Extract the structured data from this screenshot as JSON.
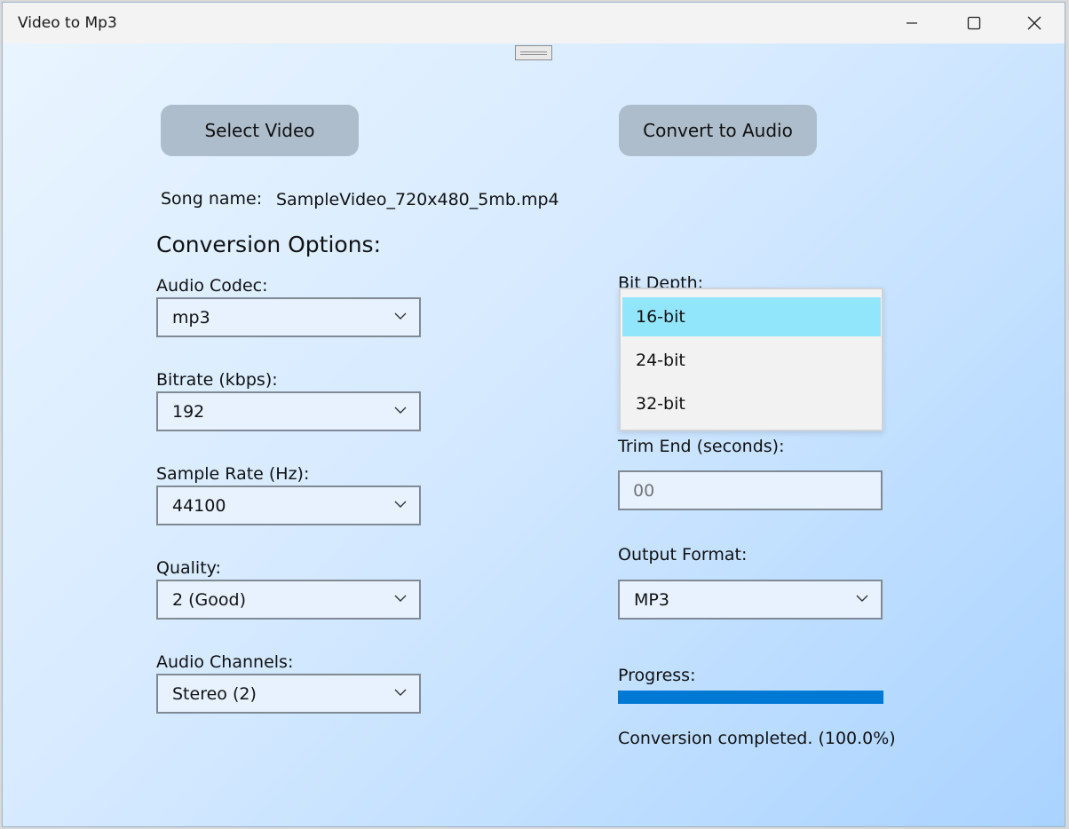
{
  "window": {
    "title": "Video to Mp3"
  },
  "actions": {
    "select_video_label": "Select Video",
    "convert_label": "Convert to Audio"
  },
  "song": {
    "label": "Song name:",
    "value": "SampleVideo_720x480_5mb.mp4"
  },
  "options": {
    "heading": "Conversion Options:",
    "audio_codec": {
      "label": "Audio Codec:",
      "value": "mp3"
    },
    "bitrate": {
      "label": "Bitrate (kbps):",
      "value": "192"
    },
    "sample_rate": {
      "label": "Sample Rate (Hz):",
      "value": "44100"
    },
    "quality": {
      "label": "Quality:",
      "value": "2 (Good)"
    },
    "channels": {
      "label": "Audio Channels:",
      "value": "Stereo (2)"
    },
    "bit_depth": {
      "label": "Bit Depth:",
      "options": [
        "16-bit",
        "24-bit",
        "32-bit"
      ],
      "selected": "16-bit"
    },
    "trim_end": {
      "label": "Trim End (seconds):",
      "placeholder": "00"
    },
    "output_format": {
      "label": "Output Format:",
      "value": "MP3"
    }
  },
  "progress": {
    "label": "Progress:",
    "percent": 100,
    "status": "Conversion completed. (100.0%)"
  },
  "colors": {
    "progress_fill": "#0078d4",
    "dropdown_highlight": "#92e6fb",
    "button_bg": "#aebdcb"
  },
  "icons": {
    "minimize": "minimize-icon",
    "maximize": "maximize-icon",
    "close": "close-icon",
    "dropdown": "chevron-down-icon"
  }
}
